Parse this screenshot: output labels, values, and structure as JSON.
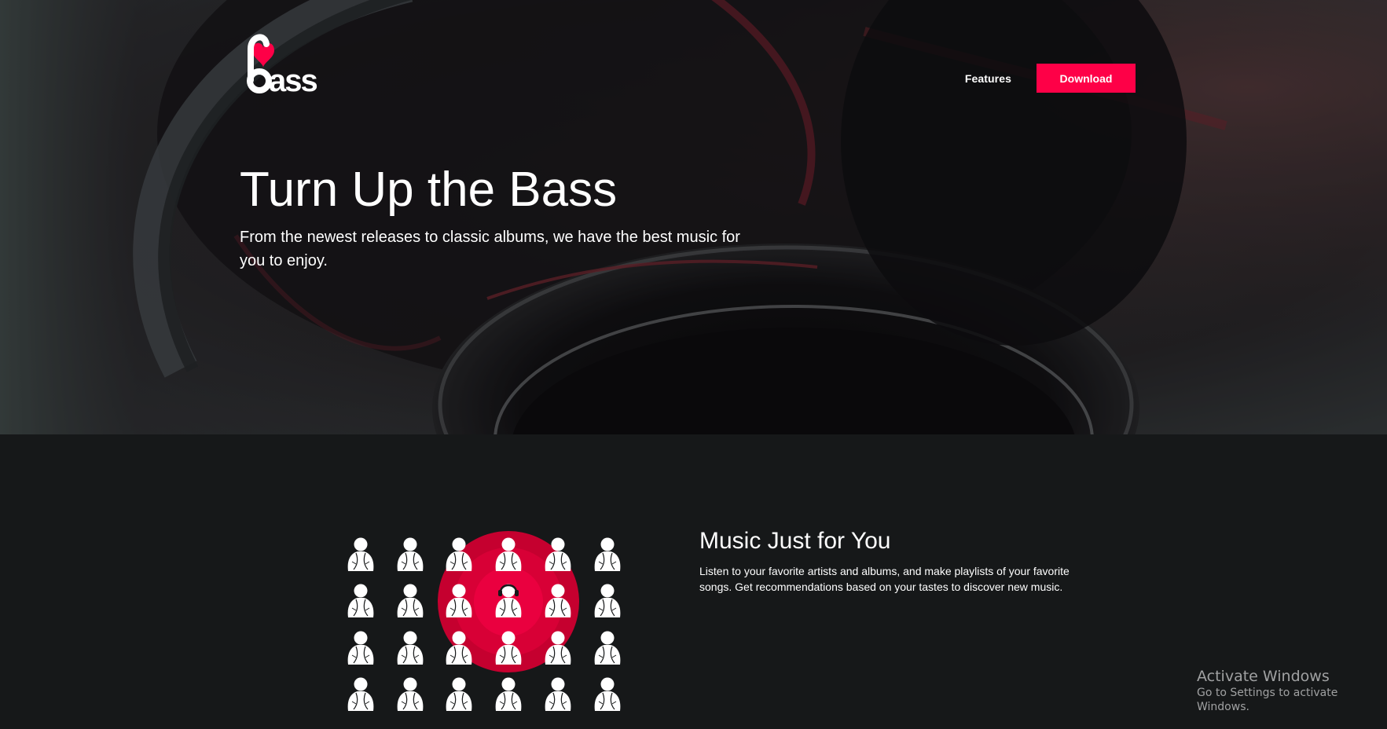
{
  "brand": {
    "name": "bass",
    "accent_color": "#fe0047"
  },
  "nav": {
    "features_label": "Features",
    "download_label": "Download"
  },
  "hero": {
    "title": "Turn Up the Bass",
    "subtitle": "From the newest releases to classic albums, we have the best music for you to enjoy.",
    "background_image": "headphones-photo"
  },
  "feature": {
    "title": "Music Just for You",
    "description": "Listen to your favorite artists and albums, and make playlists of your favorite songs. Get recommendations based on your tastes to discover new music.",
    "illustration": "person-grid-with-headphones-target-icon"
  },
  "watermark": {
    "title": "Activate Windows",
    "subtitle": "Go to Settings to activate Windows."
  }
}
